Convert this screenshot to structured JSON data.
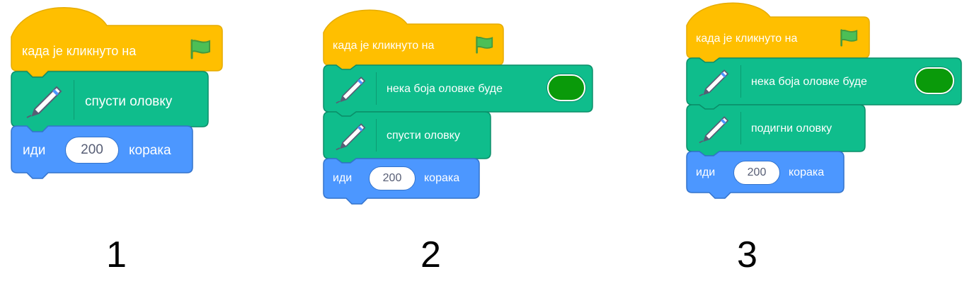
{
  "scripts": [
    {
      "hat": "када је кликнуто на",
      "blocks": [
        {
          "kind": "pen",
          "text": "спусти оловку"
        },
        {
          "kind": "motion",
          "prefix": "иди",
          "value": "200",
          "suffix": "корака"
        }
      ],
      "number": "1"
    },
    {
      "hat": "када је кликнуто на",
      "blocks": [
        {
          "kind": "pen-color",
          "text": "нека боја оловке буде"
        },
        {
          "kind": "pen",
          "text": "спусти оловку"
        },
        {
          "kind": "motion",
          "prefix": "иди",
          "value": "200",
          "suffix": "корака"
        }
      ],
      "number": "2"
    },
    {
      "hat": "када је кликнуто на",
      "blocks": [
        {
          "kind": "pen-color",
          "text": "нека боја оловке буде"
        },
        {
          "kind": "pen",
          "text": "подигни оловку"
        },
        {
          "kind": "motion",
          "prefix": "иди",
          "value": "200",
          "suffix": "корака"
        }
      ],
      "number": "3"
    }
  ],
  "colors": {
    "events": "#ffbf00",
    "events_border": "#e6ac00",
    "pen": "#0fbd8c",
    "pen_border": "#0b8e69",
    "motion": "#4c97ff",
    "motion_border": "#3373cc",
    "pen_color_value": "#0a9a0a",
    "flag": "#4cbf56"
  },
  "icons": [
    "flag-icon",
    "pen-icon"
  ]
}
